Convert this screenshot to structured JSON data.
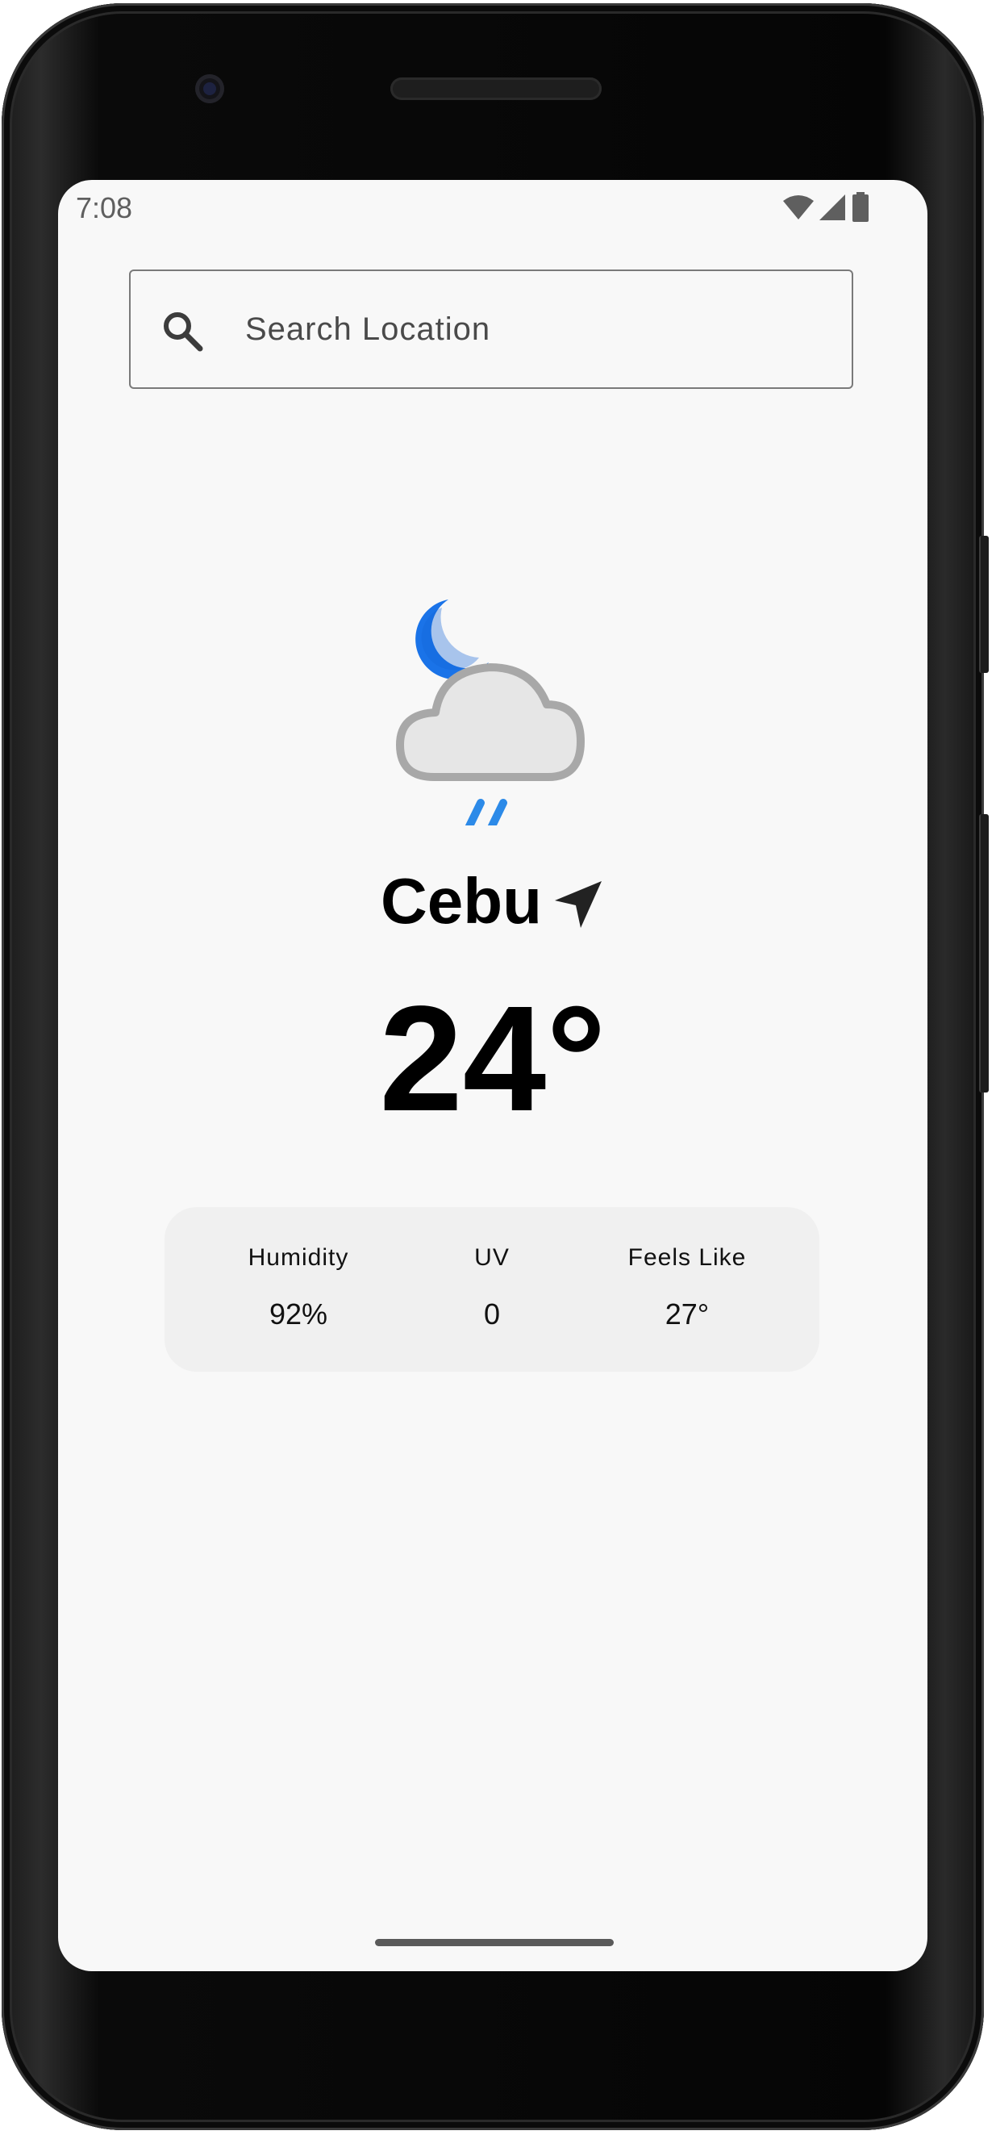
{
  "status_bar": {
    "time": "7:08",
    "icons": [
      "wifi-icon",
      "cell-signal-icon",
      "battery-icon"
    ]
  },
  "search": {
    "placeholder": "Search Location",
    "icon": "search-icon"
  },
  "weather": {
    "condition_icon": "night-cloud-rain-icon",
    "city": "Cebu",
    "location_icon": "navigation-arrow-icon",
    "temperature": "24°"
  },
  "stats": [
    {
      "label": "Humidity",
      "value": "92%"
    },
    {
      "label": "UV",
      "value": "0"
    },
    {
      "label": "Feels Like",
      "value": "27°"
    }
  ],
  "colors": {
    "accent_blue": "#1a73e8",
    "screen_bg": "#f8f8f8",
    "card_bg": "#f0f0f0"
  }
}
